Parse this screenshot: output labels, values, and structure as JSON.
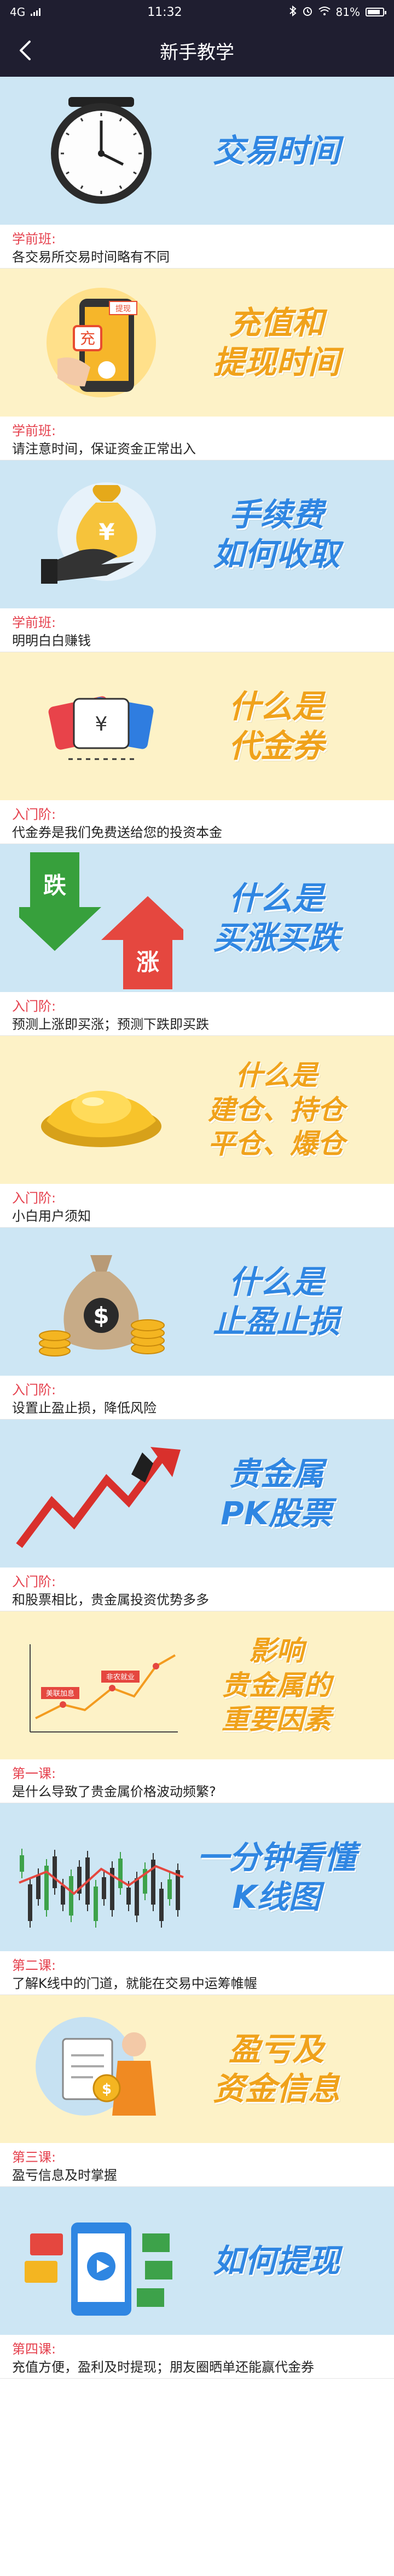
{
  "status_bar": {
    "network": "4G",
    "time": "11:32",
    "battery": "81%",
    "colors": {
      "bar_bg": "#1f1e30"
    }
  },
  "nav": {
    "title": "新手教学",
    "back_icon": "chevron-left-icon"
  },
  "colors": {
    "banner_blue": "#cde6f4",
    "banner_yellow": "#fdf2c7",
    "title_blue": "#2f86e2",
    "title_orange": "#f0a21b",
    "tag_red": "#e5404d"
  },
  "lessons": [
    {
      "theme": "blue",
      "title_lines": [
        "交易时间"
      ],
      "icon": "clock-icon",
      "tag": "学前班:",
      "desc": "各交易所交易时间略有不同"
    },
    {
      "theme": "yellow",
      "title_lines": [
        "充值和",
        "提现时间"
      ],
      "icon": "phone-recharge-icon",
      "art_labels": [
        "充",
        "提现"
      ],
      "tag": "学前班:",
      "desc": "请注意时间，保证资金正常出入"
    },
    {
      "theme": "blue",
      "title_lines": [
        "手续费",
        "如何收取"
      ],
      "icon": "money-bag-hand-icon",
      "art_labels": [
        "¥"
      ],
      "tag": "学前班:",
      "desc": "明明白白赚钱"
    },
    {
      "theme": "yellow",
      "title_lines": [
        "什么是",
        "代金券"
      ],
      "icon": "voucher-tickets-icon",
      "art_labels": [
        "¥"
      ],
      "tag": "入门阶:",
      "desc": "代金券是我们免费送给您的投资本金"
    },
    {
      "theme": "blue",
      "title_lines": [
        "什么是",
        "买涨买跌"
      ],
      "icon": "up-down-arrows-icon",
      "art_labels": [
        "跌",
        "涨"
      ],
      "tag": "入门阶:",
      "desc": "预测上涨即买涨；预测下跌即买跌"
    },
    {
      "theme": "yellow",
      "title_lines": [
        "什么是",
        "建仓、持仓",
        "平仓、爆仓"
      ],
      "icon": "gold-ingot-icon",
      "tag": "入门阶:",
      "desc": "小白用户须知"
    },
    {
      "theme": "blue",
      "title_lines": [
        "什么是",
        "止盈止损"
      ],
      "icon": "money-sack-coins-icon",
      "art_labels": [
        "$"
      ],
      "tag": "入门阶:",
      "desc": "设置止盈止损，降低风险"
    },
    {
      "theme": "blue",
      "title_lines": [
        "贵金属",
        "PK股票"
      ],
      "icon": "trend-arrow-icon",
      "tag": "入门阶:",
      "desc": "和股票相比，贵金属投资优势多多"
    },
    {
      "theme": "yellow",
      "title_lines": [
        "影响",
        "贵金属的",
        "重要因素"
      ],
      "icon": "price-line-chart-icon",
      "art_labels": [
        "美联加息",
        "非农就业"
      ],
      "tag": "第一课:",
      "desc": "是什么导致了贵金属价格波动频繁?"
    },
    {
      "theme": "blue",
      "title_lines": [
        "一分钟看懂",
        "K线图"
      ],
      "icon": "candlestick-chart-icon",
      "tag": "第二课:",
      "desc": "了解K线中的门道，就能在交易中运筹帷幄"
    },
    {
      "theme": "yellow",
      "title_lines": [
        "盈亏及",
        "资金信息"
      ],
      "icon": "person-coin-icon",
      "art_labels": [
        "$"
      ],
      "tag": "第三课:",
      "desc": "盈亏信息及时掌握"
    },
    {
      "theme": "blue",
      "title_lines": [
        "如何提现"
      ],
      "icon": "phone-withdraw-icon",
      "tag": "第四课:",
      "desc": "充值方便，盈利及时提现；朋友圈晒单还能赢代金券"
    }
  ]
}
